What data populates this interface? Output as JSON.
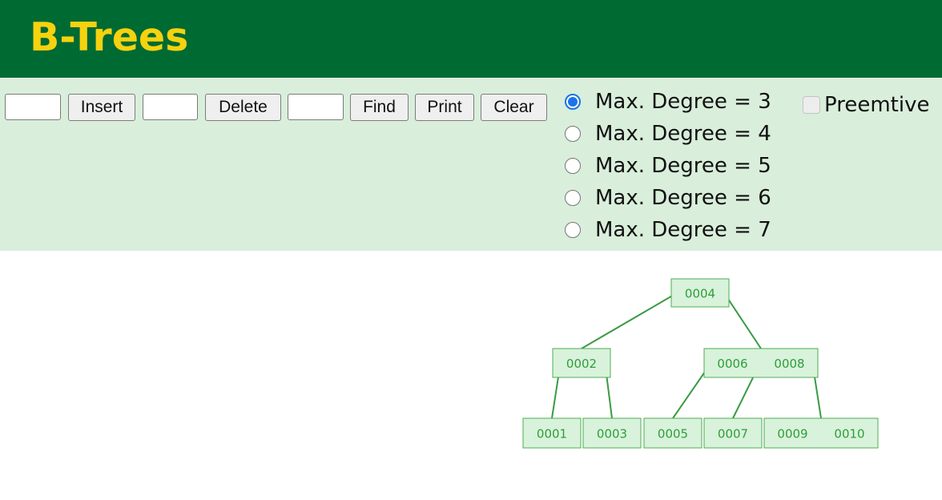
{
  "header": {
    "title": "B-Trees"
  },
  "controls": {
    "insert_input_value": "",
    "insert_label": "Insert",
    "delete_input_value": "",
    "delete_label": "Delete",
    "find_input_value": "",
    "find_label": "Find",
    "print_label": "Print",
    "clear_label": "Clear",
    "degree_options": [
      {
        "label": "Max. Degree = 3",
        "checked": true
      },
      {
        "label": "Max. Degree = 4",
        "checked": false
      },
      {
        "label": "Max. Degree = 5",
        "checked": false
      },
      {
        "label": "Max. Degree = 6",
        "checked": false
      },
      {
        "label": "Max. Degree = 7",
        "checked": false
      }
    ],
    "preemptive_label": "Preemtive",
    "preemptive_checked": false
  },
  "tree": {
    "colors": {
      "fill": "#d9f2db",
      "stroke": "#4caf50",
      "text": "#2e9e3a",
      "edge": "#3a9a44"
    },
    "root": {
      "keys": [
        "0004"
      ],
      "children": [
        {
          "keys": [
            "0002"
          ],
          "children": [
            {
              "keys": [
                "0001"
              ]
            },
            {
              "keys": [
                "0003"
              ]
            }
          ]
        },
        {
          "keys": [
            "0006",
            "0008"
          ],
          "children": [
            {
              "keys": [
                "0005"
              ]
            },
            {
              "keys": [
                "0007"
              ]
            },
            {
              "keys": [
                "0009",
                "0010"
              ]
            }
          ]
        }
      ]
    }
  }
}
